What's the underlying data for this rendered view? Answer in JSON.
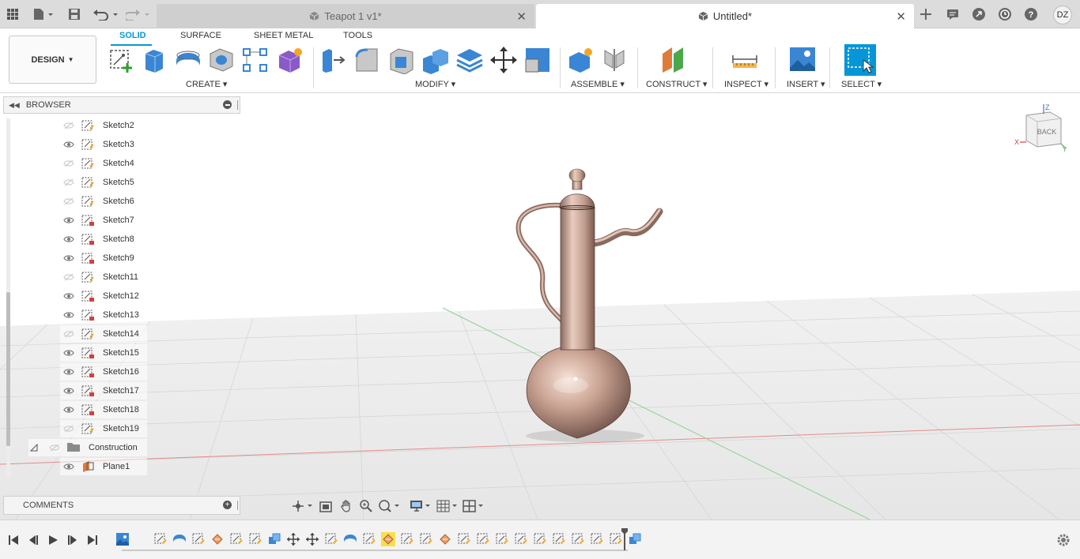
{
  "window": {
    "tabs": [
      {
        "label": "Teapot 1 v1*",
        "active": false
      },
      {
        "label": "Untitled*",
        "active": true
      }
    ],
    "user_initials": "DZ",
    "icons": [
      "apps-grid-icon",
      "file-icon",
      "save-icon",
      "undo-icon",
      "redo-icon",
      "new-tab-icon",
      "notifications-icon",
      "help-search-icon",
      "job-status-icon",
      "help-icon"
    ]
  },
  "ribbon": {
    "workspace_button": "DESIGN",
    "tabs": [
      "SOLID",
      "SURFACE",
      "SHEET METAL",
      "TOOLS"
    ],
    "active_tab": "SOLID",
    "groups": [
      "CREATE",
      "MODIFY",
      "ASSEMBLE",
      "CONSTRUCT",
      "INSPECT",
      "INSERT",
      "SELECT"
    ],
    "accent_color": "#0696d7"
  },
  "browser": {
    "title": "BROWSER",
    "items": [
      {
        "label": "Sketch2",
        "visible": false
      },
      {
        "label": "Sketch3",
        "visible": true
      },
      {
        "label": "Sketch4",
        "visible": false
      },
      {
        "label": "Sketch5",
        "visible": false
      },
      {
        "label": "Sketch6",
        "visible": false
      },
      {
        "label": "Sketch7",
        "visible": true
      },
      {
        "label": "Sketch8",
        "visible": true
      },
      {
        "label": "Sketch9",
        "visible": true
      },
      {
        "label": "Sketch11",
        "visible": false
      },
      {
        "label": "Sketch12",
        "visible": true
      },
      {
        "label": "Sketch13",
        "visible": true
      },
      {
        "label": "Sketch14",
        "visible": false
      },
      {
        "label": "Sketch15",
        "visible": true
      },
      {
        "label": "Sketch16",
        "visible": true
      },
      {
        "label": "Sketch17",
        "visible": true
      },
      {
        "label": "Sketch18",
        "visible": true
      },
      {
        "label": "Sketch19",
        "visible": false
      }
    ],
    "folder": {
      "label": "Construction"
    },
    "plane": {
      "label": "Plane1",
      "visible": true
    }
  },
  "comments": {
    "title": "COMMENTS"
  },
  "viewcube": {
    "face_label": "BACK",
    "axes": [
      "X",
      "Y",
      "Z"
    ]
  },
  "timeline": {
    "controls": [
      "go-to-start",
      "step-back",
      "play",
      "step-forward",
      "go-to-end"
    ],
    "feature_count": 27
  }
}
